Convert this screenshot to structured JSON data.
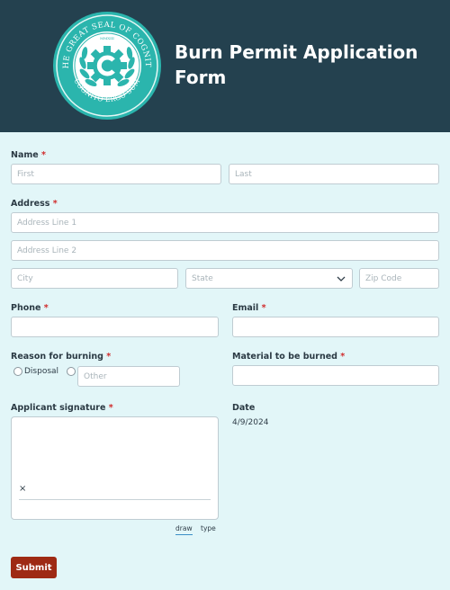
{
  "header": {
    "title": "Burn Permit Application Form",
    "seal": {
      "outer_text": "THE GREAT SEAL OF COGNITO",
      "inner_text": "COGNITO ERGO SUM",
      "small_text": "MMXIII"
    }
  },
  "form": {
    "name": {
      "label": "Name",
      "required": "*",
      "first_placeholder": "First",
      "last_placeholder": "Last"
    },
    "address": {
      "label": "Address",
      "required": "*",
      "line1_placeholder": "Address Line 1",
      "line2_placeholder": "Address Line 2",
      "city_placeholder": "City",
      "state_placeholder": "State",
      "zip_placeholder": "Zip Code"
    },
    "phone": {
      "label": "Phone",
      "required": "*"
    },
    "email": {
      "label": "Email",
      "required": "*"
    },
    "reason": {
      "label": "Reason for burning",
      "required": "*",
      "option_disposal": "Disposal",
      "other_placeholder": "Other"
    },
    "material": {
      "label": "Material to be burned",
      "required": "*"
    },
    "signature": {
      "label": "Applicant signature",
      "required": "*",
      "clear_mark": "×",
      "tab_draw": "draw",
      "tab_type": "type"
    },
    "date": {
      "label": "Date",
      "value": "4/9/2024"
    },
    "submit_label": "Submit"
  },
  "colors": {
    "header_bg": "#24414f",
    "page_bg": "#e2f6f8",
    "seal": "#2bb5ad",
    "submit_bg": "#9e2a14",
    "required": "#d02c2c"
  }
}
